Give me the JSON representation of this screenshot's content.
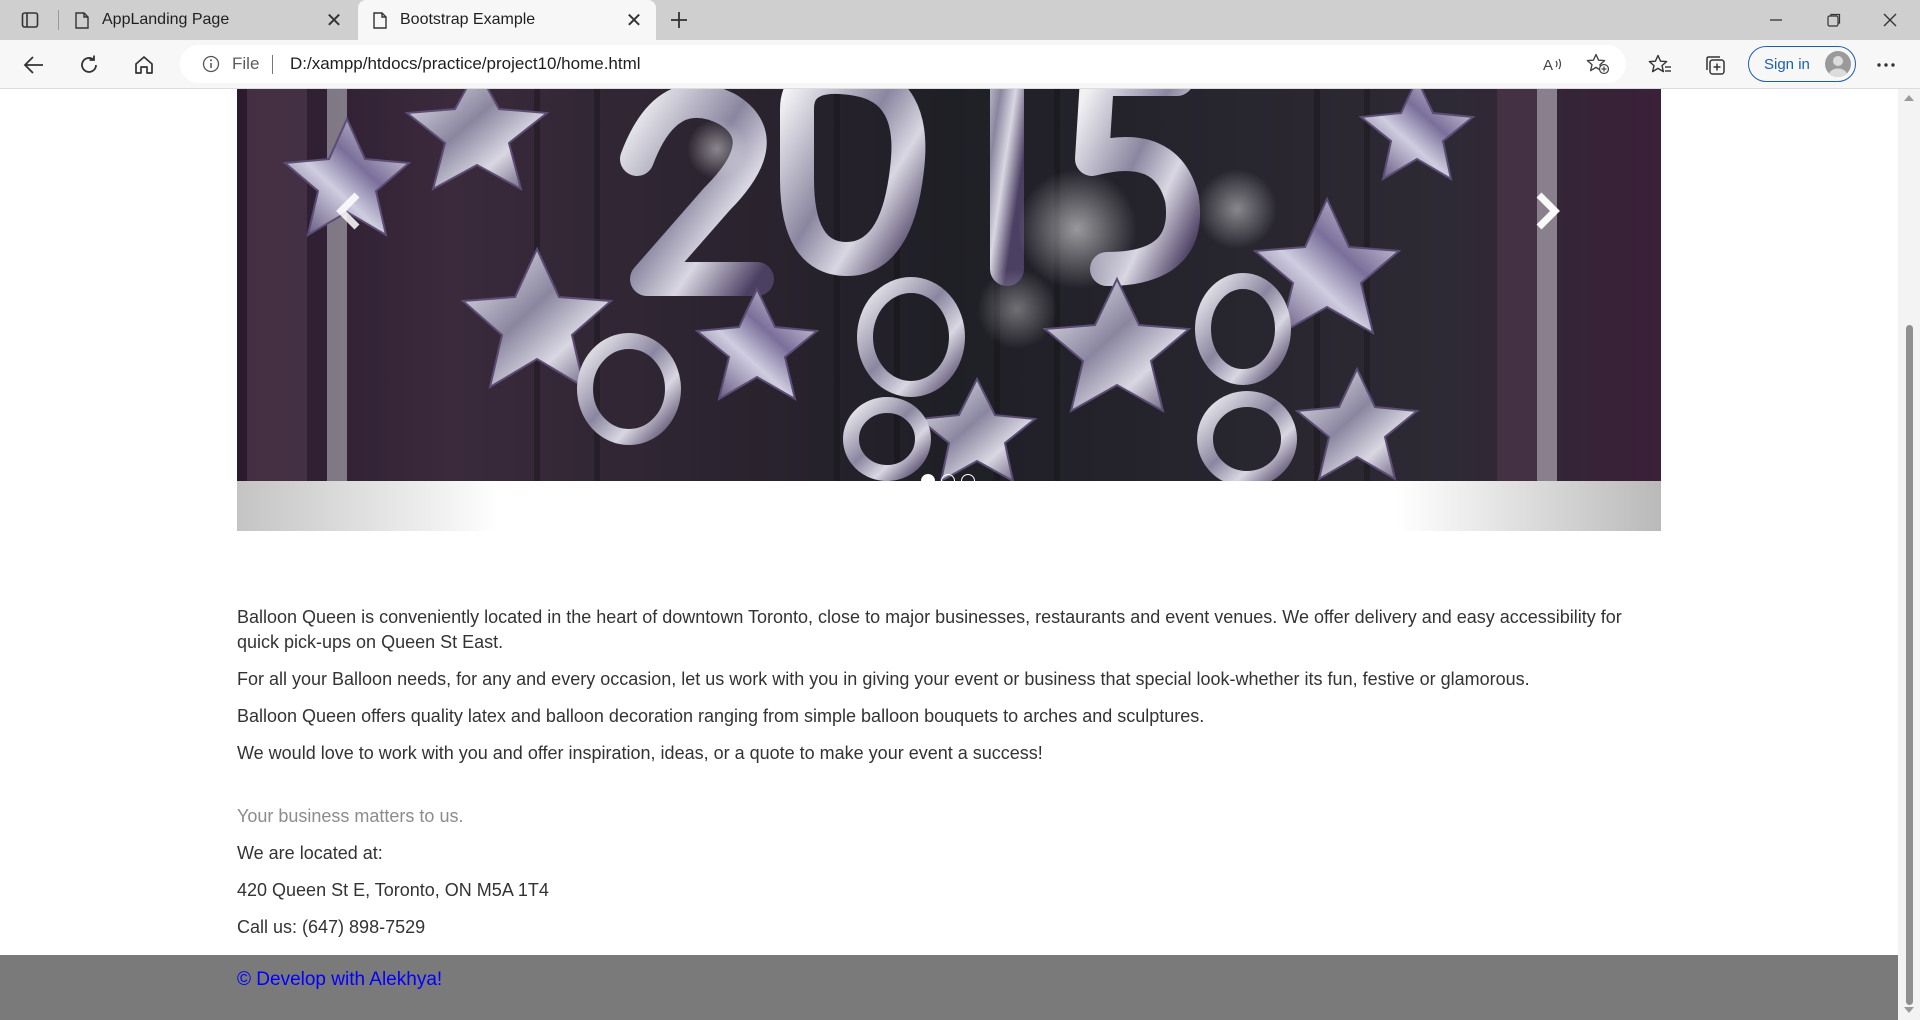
{
  "browser": {
    "tabs": [
      {
        "title": "AppLanding Page",
        "active": false
      },
      {
        "title": "Bootstrap Example",
        "active": true
      }
    ],
    "address": {
      "scheme_label": "File",
      "url": "D:/xampp/htdocs/practice/project10/home.html"
    },
    "signin_label": "Sign in"
  },
  "carousel": {
    "indicator_count": 3,
    "active_index": 0,
    "image_subject": "silver 2015 balloons and star balloons in dark room"
  },
  "content": {
    "paragraphs": [
      "Balloon Queen is conveniently located in the heart of downtown Toronto, close to major businesses, restaurants and event venues. We offer delivery and easy accessibility for quick pick-ups on Queen St East.",
      "For all your Balloon needs, for any and every occasion, let us work with you in giving your event or business that special look-whether its fun, festive or glamorous.",
      "Balloon Queen offers quality latex and balloon decoration ranging from simple balloon bouquets to arches and sculptures.",
      "We would love to work with you and offer inspiration, ideas, or a quote to make your event a success!"
    ],
    "tagline": "Your business matters to us.",
    "located_label": "We are located at:",
    "address": "420 Queen St E, Toronto, ON M5A 1T4",
    "phone": "Call us: (647) 898-7529"
  },
  "footer": {
    "copyright": "© Develop with Alekhya!"
  },
  "colors": {
    "footer_bg": "#7a7a7a",
    "footer_link": "#0000ff",
    "signin_accent": "#1b5fb0"
  }
}
